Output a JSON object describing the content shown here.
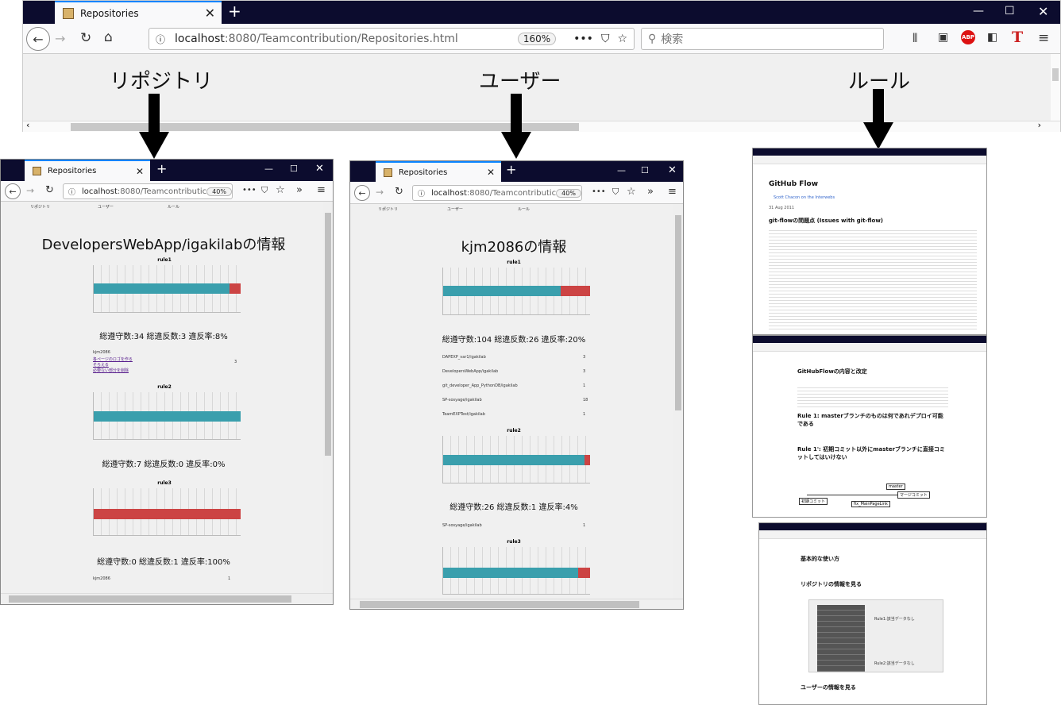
{
  "main": {
    "tab_title": "Repositories",
    "url_host": "localhost",
    "url_rest": ":8080/Teamcontribution/Repositories.html",
    "zoom": "160%",
    "search_placeholder": "検索",
    "nav_labels": [
      "リポジトリ",
      "ユーザー",
      "ルール"
    ]
  },
  "repo_window": {
    "tab_title": "Repositories",
    "url_host": "localhost",
    "url_rest": ":8080/Teamcontributic",
    "zoom": "40%",
    "nav": [
      "リポジトリ",
      "ユーザー",
      "ルール"
    ],
    "heading": "DevelopersWebApp/igakilabの情報",
    "rules": [
      {
        "title": "rule1",
        "stat": "総遵守数:34 総違反数:3 違反率:8%",
        "green_pct": 92
      },
      {
        "title": "rule2",
        "stat": "総遵守数:7 総違反数:0 違反率:0%",
        "green_pct": 100
      },
      {
        "title": "rule3",
        "stat": "総遵守数:0 総違反数:1 違反率:100%",
        "green_pct": 0
      }
    ],
    "user_block_name": "kjm2086",
    "user_block_count": "3",
    "user_block_links": [
      "各ページのロゴを作る",
      "そろえる",
      "必要ない部分を削除"
    ],
    "footer_user": "kjm2086",
    "footer_count": "1"
  },
  "user_window": {
    "tab_title": "Repositories",
    "url_host": "localhost",
    "url_rest": ":8080/Teamcontributic",
    "zoom": "40%",
    "nav": [
      "リポジトリ",
      "ユーザー",
      "ルール"
    ],
    "heading": "kjm2086の情報",
    "rules": [
      {
        "title": "rule1",
        "stat": "総遵守数:104 総違反数:26 違反率:20%",
        "green_pct": 80
      },
      {
        "title": "rule2",
        "stat": "総遵守数:26 総違反数:1 違反率:4%",
        "green_pct": 96
      },
      {
        "title": "rule3",
        "stat": "",
        "green_pct": 92
      }
    ],
    "repos": [
      {
        "name": "DAPEXP_var1/igakilab",
        "count": "3"
      },
      {
        "name": "DevelopersWebApp/igakilab",
        "count": "3"
      },
      {
        "name": "git_developer_App_PythonDB/igakilab",
        "count": "1"
      },
      {
        "name": "SP-sosyage/igakilab",
        "count": "18"
      },
      {
        "name": "TeamEXPTest/igakilab",
        "count": "1"
      }
    ],
    "repo_rule2": {
      "name": "SP-sosyage/igakilab",
      "count": "1"
    }
  },
  "rules_docs": {
    "doc1_title": "GitHub Flow",
    "doc1_subtitle": "git-flowの問題点 (Issues with git-flow)",
    "doc1_date": "31 Aug 2011",
    "doc1_author": "Scott Chacon on the Interwebs",
    "doc2_title": "GitHubFlowの内容と改定",
    "doc2_rule1": "Rule 1: masterブランチのものは何であれデプロイ可能である",
    "doc2_rule1b": "Rule 1': 初期コミット以外にmasterブランチに直接コミットしてはいけない",
    "doc2_labels": [
      "master",
      "マージコミット",
      "初期コミット",
      "fix_MainPageLink"
    ],
    "doc3_title": "基本的な使い方",
    "doc3_h1": "リポジトリの情報を見る",
    "doc3_h2": "ユーザーの情報を見る",
    "doc3_rule1": "Rule1:該当データなし",
    "doc3_rule2": "Rule2:該当データなし"
  },
  "colors": {
    "compliant": "#3a9fad",
    "violation": "#cc4444",
    "titlebar": "#0c0c2e"
  }
}
